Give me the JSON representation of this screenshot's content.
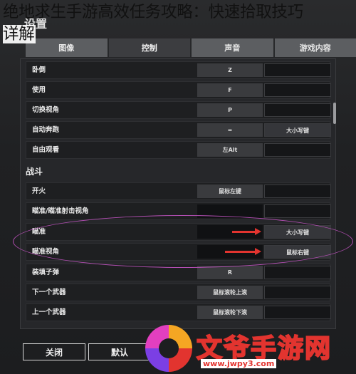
{
  "article": {
    "title_line1": "绝地求生手游高效任务攻略：快速拾取技巧",
    "title_line2": "详解"
  },
  "window": {
    "title": "设置"
  },
  "tabs": [
    {
      "label": "图像",
      "active": false
    },
    {
      "label": "控制",
      "active": true
    },
    {
      "label": "声音",
      "active": false
    },
    {
      "label": "游戏内容",
      "active": false
    }
  ],
  "rows_top": [
    {
      "label": "卧倒",
      "key1": "Z",
      "key2": ""
    },
    {
      "label": "使用",
      "key1": "F",
      "key2": ""
    },
    {
      "label": "切换视角",
      "key1": "P",
      "key2": ""
    },
    {
      "label": "自动奔跑",
      "key1": "=",
      "key2": "大小写键"
    },
    {
      "label": "自由观看",
      "key1": "左Alt",
      "key2": ""
    }
  ],
  "section_combat": "战斗",
  "rows_combat": [
    {
      "label": "开火",
      "key1": "鼠标左键",
      "key2": ""
    },
    {
      "label": "瞄准/瞄准射击视角",
      "key1": "",
      "key2": ""
    },
    {
      "label": "瞄准",
      "key1": "",
      "key2": "大小写键"
    },
    {
      "label": "瞄准视角",
      "key1": "",
      "key2": "鼠标右键"
    },
    {
      "label": "装填子弹",
      "key1": "R",
      "key2": ""
    },
    {
      "label": "下一个武器",
      "key1": "鼠标滚轮上滚",
      "key2": ""
    },
    {
      "label": "上一个武器",
      "key1": "鼠标滚轮下滚",
      "key2": ""
    }
  ],
  "buttons": {
    "close": "关闭",
    "default": "默认"
  },
  "watermark": {
    "text": "文爷手游网",
    "url": "www.jwpy3.com"
  },
  "colors": {
    "arrow": "#e2342f",
    "ellipse": "#b44fb4"
  }
}
